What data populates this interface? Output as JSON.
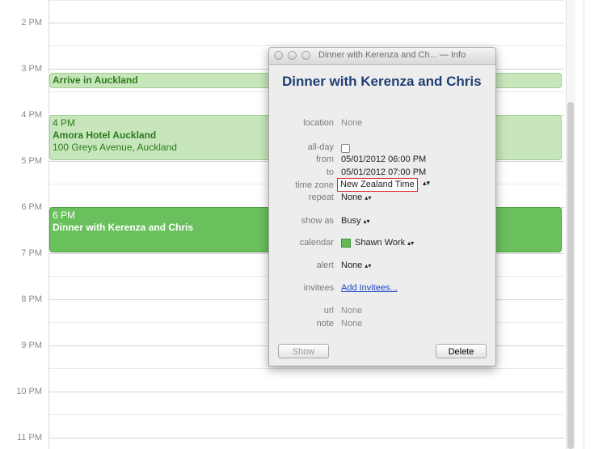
{
  "hours": [
    "2 PM",
    "3 PM",
    "4 PM",
    "5 PM",
    "6 PM",
    "7 PM",
    "8 PM",
    "9 PM",
    "10 PM",
    "11 PM"
  ],
  "events": {
    "arrive": {
      "title": "Arrive in Auckland"
    },
    "hotel": {
      "time": "4 PM",
      "title": "Amora Hotel Auckland",
      "location": "100 Greys Avenue, Auckland"
    },
    "dinner": {
      "time": "6 PM",
      "title": "Dinner with Kerenza and Chris"
    }
  },
  "info": {
    "window_title": "Dinner with Kerenza and Ch... — Info",
    "title": "Dinner with Kerenza and Chris",
    "fields": {
      "location_label": "location",
      "location_value": "None",
      "allday_label": "all-day",
      "from_label": "from",
      "from_value": "05/01/2012 06:00 PM",
      "to_label": "to",
      "to_value": "05/01/2012 07:00 PM",
      "timezone_label": "time zone",
      "timezone_value": "New Zealand Time",
      "repeat_label": "repeat",
      "repeat_value": "None",
      "showas_label": "show as",
      "showas_value": "Busy",
      "calendar_label": "calendar",
      "calendar_value": "Shawn Work",
      "alert_label": "alert",
      "alert_value": "None",
      "invitees_label": "invitees",
      "invitees_value": "Add Invitees...",
      "url_label": "url",
      "url_value": "None",
      "note_label": "note",
      "note_value": "None"
    },
    "buttons": {
      "show": "Show",
      "delete": "Delete"
    },
    "colors": {
      "calendar_swatch": "#62b956",
      "highlight": "#d42a2a",
      "title": "#1f3f74"
    }
  }
}
